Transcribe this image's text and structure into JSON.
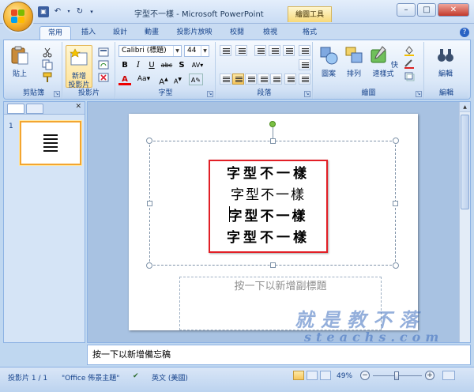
{
  "window": {
    "title": "字型不一樣 - Microsoft PowerPoint",
    "contextual_tab_group": "繪圖工具",
    "minimize": "–",
    "restore": "□",
    "close": "✕"
  },
  "tabs": [
    "常用",
    "插入",
    "設計",
    "動畫",
    "投影片放映",
    "校閱",
    "檢視",
    "格式"
  ],
  "active_tab": "常用",
  "ribbon": {
    "clipboard": {
      "label": "剪貼簿",
      "paste": "貼上"
    },
    "slides": {
      "label": "投影片",
      "new_slide": "新增",
      "new_slide2": "投影片 ▾"
    },
    "font": {
      "label": "字型",
      "font_name": "Calibri (標題)",
      "font_size": "44"
    },
    "paragraph": {
      "label": "段落"
    },
    "drawing": {
      "label": "繪圖",
      "shapes": "圖案",
      "arrange": "排列",
      "quick_styles": "快速樣式"
    },
    "editing": {
      "label": "編輯",
      "editing": "編輯"
    }
  },
  "slide_panel": {
    "slide_number": "1"
  },
  "slide": {
    "title_lines": [
      "字型不一樣",
      "字型不一樣",
      "字型不一樣",
      "字型不一樣"
    ],
    "subtitle_placeholder": "按一下以新增副標題"
  },
  "notes": {
    "placeholder": "按一下以新增備忘稿"
  },
  "statusbar": {
    "slide_info": "投影片 1 / 1",
    "theme": "\"Office 佈景主題\"",
    "language": "英文 (美國)",
    "zoom": "49%"
  },
  "watermark": {
    "cn": "就是教不落",
    "url": "steachs.com"
  },
  "colors": {
    "accent": "#15428b",
    "title_frame": "#e21f26",
    "selected_thumb": "#f3a530"
  }
}
